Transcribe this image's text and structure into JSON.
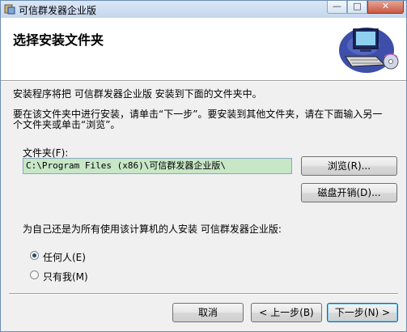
{
  "window": {
    "title": "可信群发器企业版",
    "min_glyph": "—",
    "max_glyph": "□",
    "close_glyph": "✕"
  },
  "header": {
    "title": "选择安装文件夹"
  },
  "body": {
    "intro": "安装程序将把 可信群发器企业版 安装到下面的文件夹中。",
    "instruction_line1": "要在该文件夹中进行安装，请单击“下一步”。要安装到其他文件夹，请在下面输入另一",
    "instruction_line2": "个文件夹或单击“浏览”。",
    "folder_label": "文件夹(F):",
    "folder_path": "C:\\Program Files (x86)\\可信群发器企业版\\",
    "browse_button": "浏览(R)...",
    "disk_cost_button": "磁盘开销(D)...",
    "question": "为自己还是为所有使用该计算机的人安装 可信群发器企业版:",
    "options": [
      {
        "label": "任何人(E)",
        "checked": true
      },
      {
        "label": "只有我(M)",
        "checked": false
      }
    ]
  },
  "footer": {
    "cancel_button": "取消",
    "back_button": "< 上一步(B)",
    "next_button": "下一步(N) >"
  }
}
